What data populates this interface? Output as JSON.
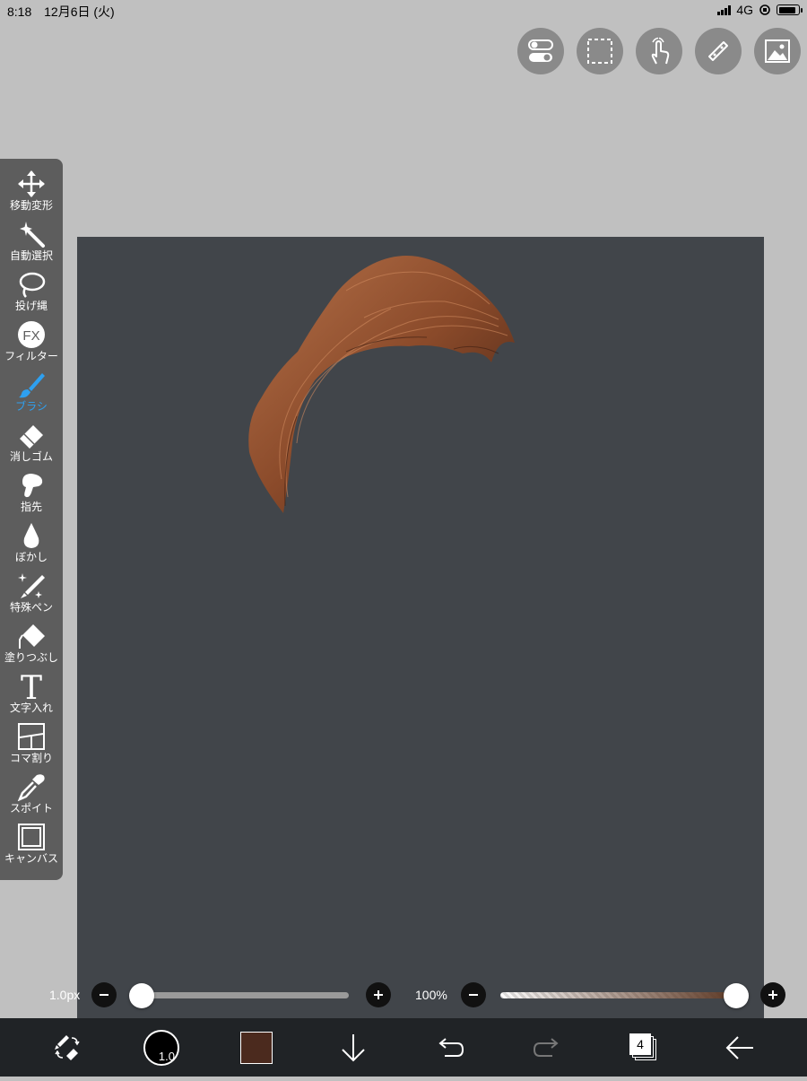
{
  "status_bar": {
    "time": "8:18",
    "date": "12月6日 (火)",
    "network": "4G"
  },
  "top_tools": [
    {
      "name": "toggle-settings-icon"
    },
    {
      "name": "selection-icon"
    },
    {
      "name": "gesture-icon"
    },
    {
      "name": "ruler-icon"
    },
    {
      "name": "material-image-icon"
    }
  ],
  "toolbar": {
    "tools": [
      {
        "label": "移動変形",
        "icon": "move-icon"
      },
      {
        "label": "自動選択",
        "icon": "magic-wand-icon"
      },
      {
        "label": "投げ縄",
        "icon": "lasso-icon"
      },
      {
        "label": "フィルター",
        "icon": "fx-icon",
        "icon_text": "FX"
      },
      {
        "label": "ブラシ",
        "icon": "brush-icon",
        "active": true
      },
      {
        "label": "消しゴム",
        "icon": "eraser-icon"
      },
      {
        "label": "指先",
        "icon": "finger-icon"
      },
      {
        "label": "ぼかし",
        "icon": "blur-drop-icon"
      },
      {
        "label": "特殊ペン",
        "icon": "special-pen-icon"
      },
      {
        "label": "塗りつぶし",
        "icon": "bucket-fill-icon"
      },
      {
        "label": "文字入れ",
        "icon": "text-icon",
        "icon_text": "T"
      },
      {
        "label": "コマ割り",
        "icon": "panel-divide-icon"
      },
      {
        "label": "スポイト",
        "icon": "eyedropper-icon"
      },
      {
        "label": "キャンバス",
        "icon": "canvas-icon"
      }
    ],
    "accent_color": "#2ea0f0"
  },
  "sliders": {
    "size": {
      "label": "1.0px",
      "level": 0.0
    },
    "opacity": {
      "label": "100%",
      "level": 1.0
    }
  },
  "bottom_bar": {
    "brush_size_value": "1.0",
    "current_color": "#4b2a1e",
    "layer_count": "4"
  },
  "canvas": {
    "background_color": "#41454a"
  }
}
